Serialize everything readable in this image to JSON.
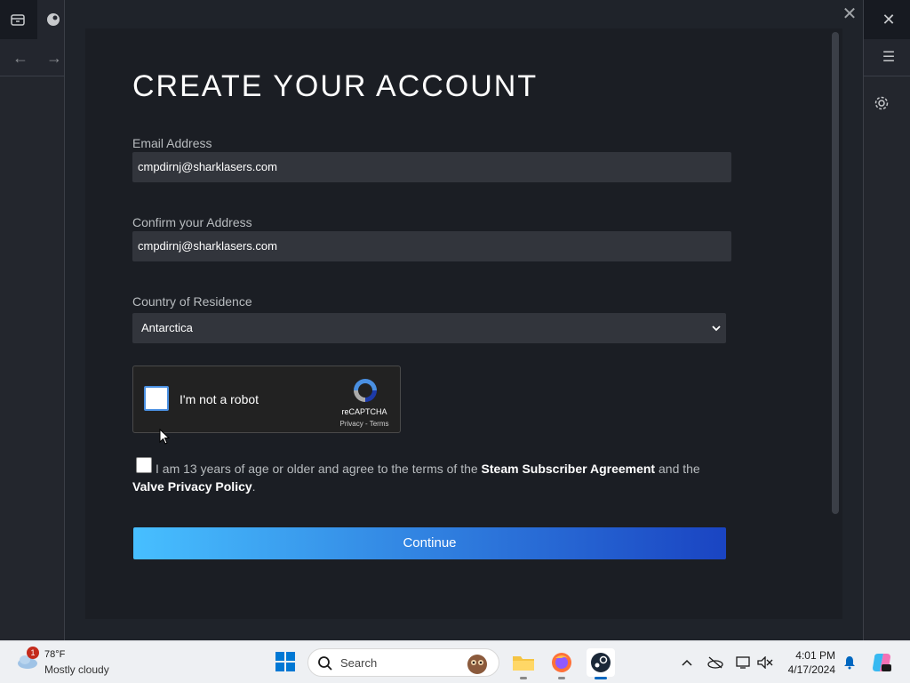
{
  "modal": {
    "title": "CREATE YOUR ACCOUNT",
    "close_icon": "close-icon",
    "email": {
      "label": "Email Address",
      "value": "cmpdirnj@sharklasers.com"
    },
    "confirm_email": {
      "label": "Confirm your Address",
      "value": "cmpdirnj@sharklasers.com"
    },
    "country": {
      "label": "Country of Residence",
      "selected": "Antarctica"
    },
    "recaptcha": {
      "label": "I'm not a robot",
      "brand": "reCAPTCHA",
      "links": "Privacy - Terms"
    },
    "agreement": {
      "prefix": "I am 13 years of age or older and agree to the terms of the ",
      "link1": "Steam Subscriber Agreement",
      "middle": " and the ",
      "link2": "Valve Privacy Policy",
      "suffix": "."
    },
    "continue_label": "Continue"
  },
  "taskbar": {
    "weather": {
      "temp": "78°F",
      "description": "Mostly cloudy",
      "badge": "1"
    },
    "search_placeholder": "Search",
    "clock": {
      "time": "4:01 PM",
      "date": "4/17/2024"
    }
  },
  "colors": {
    "accent_start": "#47bfff",
    "accent_end": "#1a44c2",
    "modal_bg": "#1b1e24",
    "input_bg": "#32353c"
  }
}
